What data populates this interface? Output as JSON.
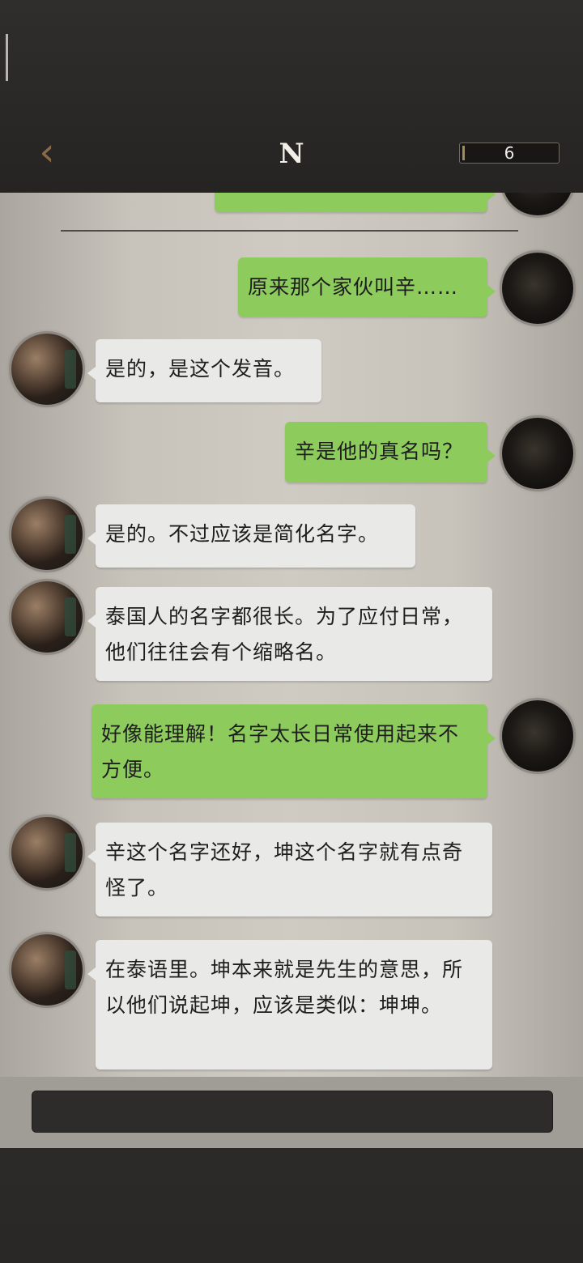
{
  "header": {
    "back_icon": "chevron-left-icon",
    "title": "N",
    "counter": "6"
  },
  "messages": [
    {
      "sender": "me",
      "text": "原来那个家伙叫辛……"
    },
    {
      "sender": "partner",
      "text": "是的，是这个发音。"
    },
    {
      "sender": "me",
      "text": "辛是他的真名吗？"
    },
    {
      "sender": "partner",
      "text": "是的。不过应该是简化名字。"
    },
    {
      "sender": "partner",
      "text": "泰国人的名字都很长。为了应付日常，他们往往会有个缩略名。"
    },
    {
      "sender": "me",
      "text": "好像能理解！名字太长日常使用起来不方便。"
    },
    {
      "sender": "partner",
      "text": "辛这个名字还好，坤这个名字就有点奇怪了。"
    },
    {
      "sender": "partner",
      "text": "在泰语里。坤本来就是先生的意思，所以他们说起坤，应该是类似：坤坤。"
    }
  ],
  "colors": {
    "my_bubble": "#8dcb5d",
    "partner_bubble": "#e9e9e8",
    "header_bg": "#2c2a28",
    "back_icon": "#8a6b48"
  }
}
